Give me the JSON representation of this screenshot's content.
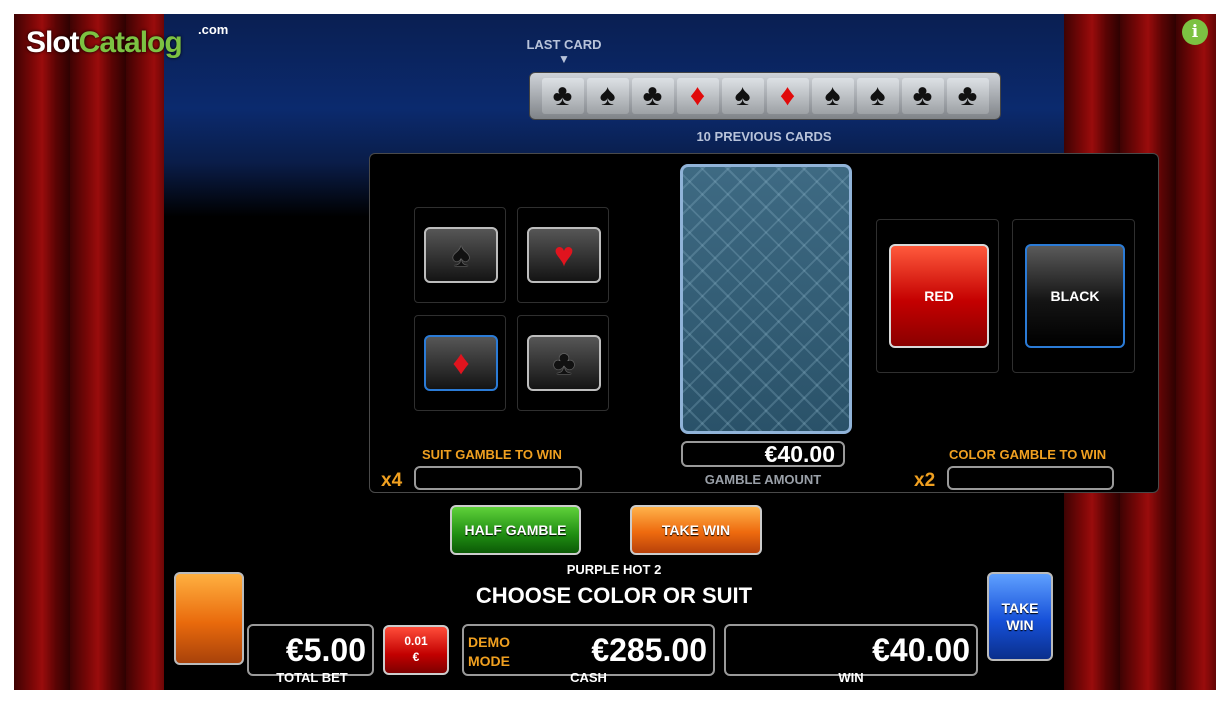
{
  "branding": {
    "logo_slot": "Slot",
    "logo_catalog": "Catalog",
    "logo_com": ".com",
    "info_icon": "i"
  },
  "previous_cards": {
    "last_card_label": "LAST CARD",
    "arrow": "▼",
    "cards": [
      "♣",
      "♠",
      "♣",
      "♦",
      "♠",
      "♦",
      "♠",
      "♠",
      "♣",
      "♣"
    ],
    "label": "10 PREVIOUS CARDS"
  },
  "suit_buttons": [
    "♠",
    "♥",
    "♦",
    "♣"
  ],
  "suit_gamble": {
    "label": "SUIT GAMBLE TO WIN",
    "multiplier": "x4"
  },
  "card": {
    "gamble_amount_value": "€40.00",
    "gamble_amount_label": "GAMBLE AMOUNT"
  },
  "color_buttons": {
    "red": "RED",
    "black": "BLACK"
  },
  "color_gamble": {
    "label": "COLOR GAMBLE TO WIN",
    "multiplier": "x2"
  },
  "actions": {
    "half_gamble": "HALF GAMBLE",
    "take_win": "TAKE WIN"
  },
  "game_name": "PURPLE HOT 2",
  "prompt": "CHOOSE COLOR OR SUIT",
  "bottom": {
    "total_bet_value": "€5.00",
    "total_bet_label": "TOTAL BET",
    "coin_line1": "0.01",
    "coin_line2": "€",
    "demo_line1": "DEMO",
    "demo_line2": "MODE",
    "cash_value": "€285.00",
    "cash_label": "CASH",
    "win_value": "€40.00",
    "win_label": "WIN",
    "take_win_line1": "TAKE",
    "take_win_line2": "WIN"
  },
  "colors": {
    "gold": "#f0a020",
    "selected_border": "#2b7bd6",
    "logo_green": "#7cc242"
  }
}
